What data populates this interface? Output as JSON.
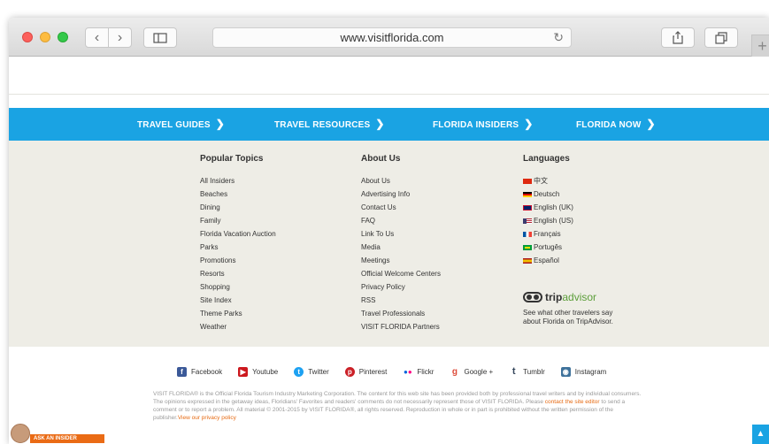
{
  "browser": {
    "url": "www.visitflorida.com"
  },
  "nav": [
    {
      "label": "TRAVEL GUIDES"
    },
    {
      "label": "TRAVEL RESOURCES"
    },
    {
      "label": "FLORIDA INSIDERS"
    },
    {
      "label": "FLORIDA NOW"
    }
  ],
  "columns": {
    "popular": {
      "title": "Popular Topics",
      "items": [
        "All Insiders",
        "Beaches",
        "Dining",
        "Family",
        "Florida Vacation Auction",
        "Parks",
        "Promotions",
        "Resorts",
        "Shopping",
        "Site Index",
        "Theme Parks",
        "Weather"
      ]
    },
    "about": {
      "title": "About Us",
      "items": [
        "About Us",
        "Advertising Info",
        "Contact Us",
        "FAQ",
        "Link To Us",
        "Media",
        "Meetings",
        "Official Welcome Centers",
        "Privacy Policy",
        "RSS",
        "Travel Professionals",
        "VISIT FLORIDA Partners"
      ]
    },
    "languages": {
      "title": "Languages",
      "items": [
        "中文",
        "Deutsch",
        "English (UK)",
        "English (US)",
        "Français",
        "Portugês",
        "Español"
      ]
    }
  },
  "tripadvisor": {
    "logo_a": "trip",
    "logo_b": "advisor",
    "text": "See what other travelers say about Florida on TripAdvisor."
  },
  "social": [
    {
      "label": "Facebook",
      "icon": "facebook-icon",
      "color": "#3b5998"
    },
    {
      "label": "Youtube",
      "icon": "youtube-icon",
      "color": "#cc181e"
    },
    {
      "label": "Twitter",
      "icon": "twitter-icon",
      "color": "#1da1f2"
    },
    {
      "label": "Pinterest",
      "icon": "pinterest-icon",
      "color": "#cb2027"
    },
    {
      "label": "Flickr",
      "icon": "flickr-icon",
      "color": "#0063dc"
    },
    {
      "label": "Google +",
      "icon": "google-plus-icon",
      "color": "#dd4b39"
    },
    {
      "label": "Tumblr",
      "icon": "tumblr-icon",
      "color": "#35465c"
    },
    {
      "label": "Instagram",
      "icon": "instagram-icon",
      "color": "#3f729b"
    }
  ],
  "legal": {
    "part1": "VISIT FLORIDA® is the Official Florida Tourism Industry Marketing Corporation. The content for this web site has been provided both by professional travel writers and by individual consumers. The opinions expressed in the getaway ideas, Floridians' Favorites and readers' comments do not necessarily represent those of VISIT FLORIDA. Please ",
    "link1": "contact the site editor",
    "part2": " to send a comment or to report a problem. All material © 2001-2015 by VISIT FLORIDA®, all rights reserved. Reproduction in whole or in part is prohibited without the written permission of the publisher.",
    "link2": "View our privacy policy"
  },
  "ask": {
    "label": "ASK AN INSIDER"
  },
  "colors": {
    "nav_blue": "#1aa3e3",
    "footer_beige": "#eeede6",
    "accent_orange": "#e66a12"
  }
}
